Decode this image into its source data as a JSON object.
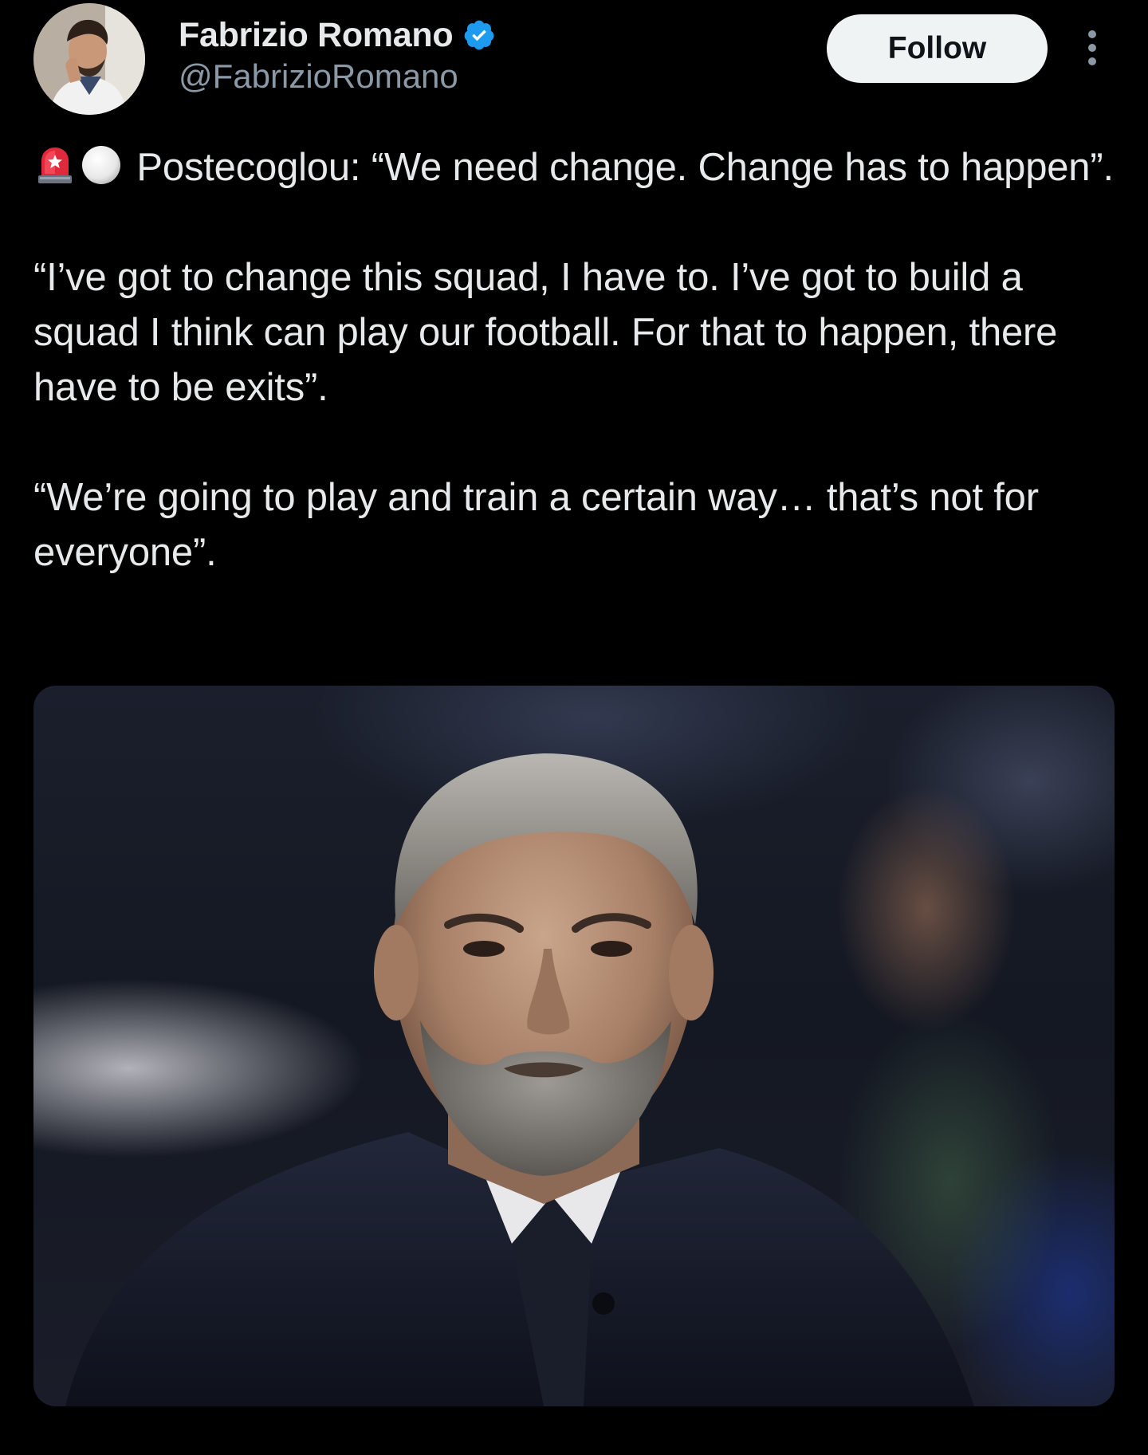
{
  "author": {
    "display_name": "Fabrizio Romano",
    "handle": "@FabrizioRomano",
    "verified": true
  },
  "actions": {
    "follow_label": "Follow"
  },
  "icons": {
    "verified": "verified-badge-icon",
    "more": "more-vertical-icon",
    "emoji_1": "police-car-light-emoji",
    "emoji_2": "white-circle-emoji"
  },
  "tweet": {
    "paragraph_1_text": "Postecoglou: “We need change. Change has to happen”.",
    "paragraph_2_text": "“I’ve got to change this squad, I have to. I’ve got to build a squad I think can play our football. For that to happen, there have to be exits”.",
    "paragraph_3_text": "“We’re going to play and train a certain way… that’s not for everyone”."
  },
  "colors": {
    "background": "#000000",
    "text_primary": "#e7e9ea",
    "text_secondary": "#8b98a5",
    "verified_blue": "#1d9bf0",
    "follow_button_bg": "#eff3f4"
  }
}
